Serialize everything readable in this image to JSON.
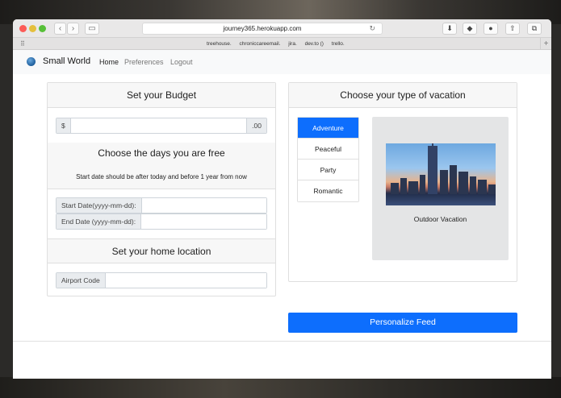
{
  "browser": {
    "url": "journey365.herokuapp.com",
    "reload_glyph": "↻",
    "bookmarks": [
      "treehouse.",
      "chroniccareemail.",
      "jira.",
      "dev.to ()",
      "trello."
    ]
  },
  "nav": {
    "brand": "Small World",
    "links": {
      "home": "Home",
      "preferences": "Preferences",
      "logout": "Logout"
    }
  },
  "budget": {
    "title": "Set your Budget",
    "prefix": "$",
    "suffix": ".00",
    "value": ""
  },
  "days": {
    "title": "Choose the days you are free",
    "hint": "Start date should be after today and before 1 year from now",
    "start_label": "Start Date(yyyy-mm-dd):",
    "start_value": "",
    "end_label": "End Date (yyyy-mm-dd):",
    "end_value": ""
  },
  "home": {
    "title": "Set your home location",
    "airport_label": "Airport Code",
    "airport_value": ""
  },
  "vacation": {
    "title": "Choose your type of vacation",
    "types": [
      "Adventure",
      "Peaceful",
      "Party",
      "Romantic"
    ],
    "selected": "Adventure",
    "preview_caption": "Outdoor Vacation"
  },
  "cta": {
    "label": "Personalize Feed"
  },
  "colors": {
    "primary": "#0d6efd",
    "card_header": "#f7f7f7",
    "preview_bg": "#e4e5e6"
  },
  "icons": [
    "back-icon",
    "forward-icon",
    "sidebar-icon",
    "download-icon",
    "evernote-icon",
    "adblock-icon",
    "share-icon",
    "tabs-icon",
    "globe-icon"
  ]
}
